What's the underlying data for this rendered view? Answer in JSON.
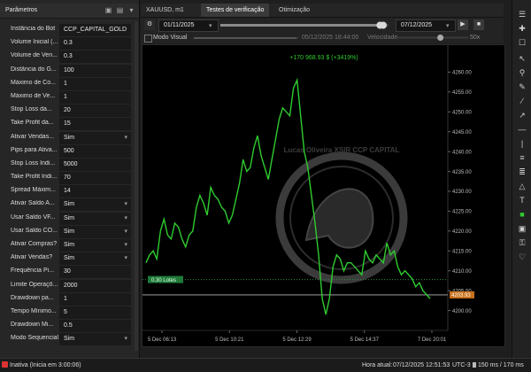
{
  "left_panel": {
    "title": "Parâmetros",
    "params": [
      {
        "label": "Instância do Bot",
        "value": "CCP_CAPITAL_GOLD",
        "dropdown": false
      },
      {
        "label": "Volume Inicial (...",
        "value": "0.3",
        "dropdown": false
      },
      {
        "label": "Volume de Ven...",
        "value": "0.3",
        "dropdown": false
      },
      {
        "label": "Distância do G...",
        "value": "100",
        "dropdown": false
      },
      {
        "label": "Máximo de Co...",
        "value": "1",
        "dropdown": false
      },
      {
        "label": "Máximo de Ve...",
        "value": "1",
        "dropdown": false
      },
      {
        "label": "Stop Loss da...",
        "value": "20",
        "dropdown": false
      },
      {
        "label": "Take Profit da...",
        "value": "15",
        "dropdown": false
      },
      {
        "label": "Ativar Vendas...",
        "value": "Sim",
        "dropdown": true
      },
      {
        "label": "Pips para Ativa...",
        "value": "500",
        "dropdown": false
      },
      {
        "label": "Stop Loss Indi...",
        "value": "5000",
        "dropdown": false
      },
      {
        "label": "Take Profit Indi...",
        "value": "70",
        "dropdown": false
      },
      {
        "label": "Spread Máxim...",
        "value": "14",
        "dropdown": false
      },
      {
        "label": "Ativar Saldo A...",
        "value": "Sim",
        "dropdown": true
      },
      {
        "label": "Usar Saldo VF...",
        "value": "Sim",
        "dropdown": true
      },
      {
        "label": "Usar Saldo CO...",
        "value": "Sim",
        "dropdown": true
      },
      {
        "label": "Ativar Compras?",
        "value": "Sim",
        "dropdown": true
      },
      {
        "label": "Ativar Vendas?",
        "value": "Sim",
        "dropdown": true
      },
      {
        "label": "Frequência Pi...",
        "value": "30",
        "dropdown": false
      },
      {
        "label": "Limite Operaçõ...",
        "value": "2000",
        "dropdown": false
      },
      {
        "label": "Drawdown pa...",
        "value": "1",
        "dropdown": false
      },
      {
        "label": "Tempo Mínimo...",
        "value": "5",
        "dropdown": false
      },
      {
        "label": "Drawdown Mi...",
        "value": "0.5",
        "dropdown": false
      },
      {
        "label": "Modo Sequencial",
        "value": "Sim",
        "dropdown": true
      }
    ]
  },
  "tabs": {
    "symbol": "XAUUSD",
    "timeframe": "m1",
    "items": [
      "Testes de verificação",
      "Otimização"
    ],
    "active": 0
  },
  "controls": {
    "start_date": "01/11/2025",
    "end_date": "07/12/2025",
    "visual_mode_label": "Modo Visual",
    "current_time": "05/12/2025 18:44:00",
    "speed_label": "Velocidade",
    "speed_value": "50x",
    "progress_fraction": 0.98,
    "speed_fraction": 0.62
  },
  "chart_data": {
    "type": "line",
    "profit_label": "+170 968.93 $ (+3419%)",
    "lots_label": "0.30 Lotes",
    "current_price_label": "4203.93",
    "current_price": 4203.93,
    "lots_price": 4207.8,
    "ylim": [
      4195,
      4265
    ],
    "y_ticks": [
      4200,
      4205,
      4210,
      4215,
      4220,
      4225,
      4230,
      4235,
      4240,
      4245,
      4250,
      4255,
      4260
    ],
    "x_ticks": [
      "5 Dec 06:13",
      "5 Dec 10:21",
      "5 Dec 12:29",
      "5 Dec 14:37",
      "7 Dec 20:01"
    ],
    "line_color": "#2fcc2f",
    "series": [
      {
        "values": [
          4212,
          4214,
          4215,
          4213,
          4220,
          4223,
          4219,
          4218,
          4222,
          4221,
          4218,
          4216,
          4219,
          4220,
          4226,
          4229,
          4227,
          4224,
          4231,
          4229,
          4228,
          4226,
          4225,
          4222,
          4224,
          4228,
          4232,
          4238,
          4235,
          4236,
          4241,
          4244,
          4239,
          4236,
          4233,
          4238,
          4243,
          4248,
          4251,
          4250,
          4249,
          4256,
          4258,
          4249,
          4240,
          4236,
          4229,
          4222,
          4214,
          4203,
          4199,
          4203,
          4211,
          4214,
          4213,
          4210,
          4212,
          4212,
          4211,
          4210,
          4209,
          4215,
          4213,
          4212,
          4214,
          4213,
          4212,
          4217,
          4214,
          4215,
          4211,
          4209,
          4210,
          4209,
          4208,
          4206,
          4207,
          4205,
          4204,
          4203
        ]
      }
    ]
  },
  "watermark": {
    "text": "Lucas Oliveira XSIR CCP CAPITAL"
  },
  "status_bar": {
    "state": "Inativa (Inicia em 3:00:06)",
    "time_label": "Hora atual:",
    "time_value": "07/12/2025 12:51:53",
    "timezone": "UTC-3",
    "latency": "150 ms / 170 ms"
  },
  "colors": {
    "accent": "#2fcc2f",
    "price_tag": "#c8701a",
    "lots_tag": "#1f7a3a"
  }
}
